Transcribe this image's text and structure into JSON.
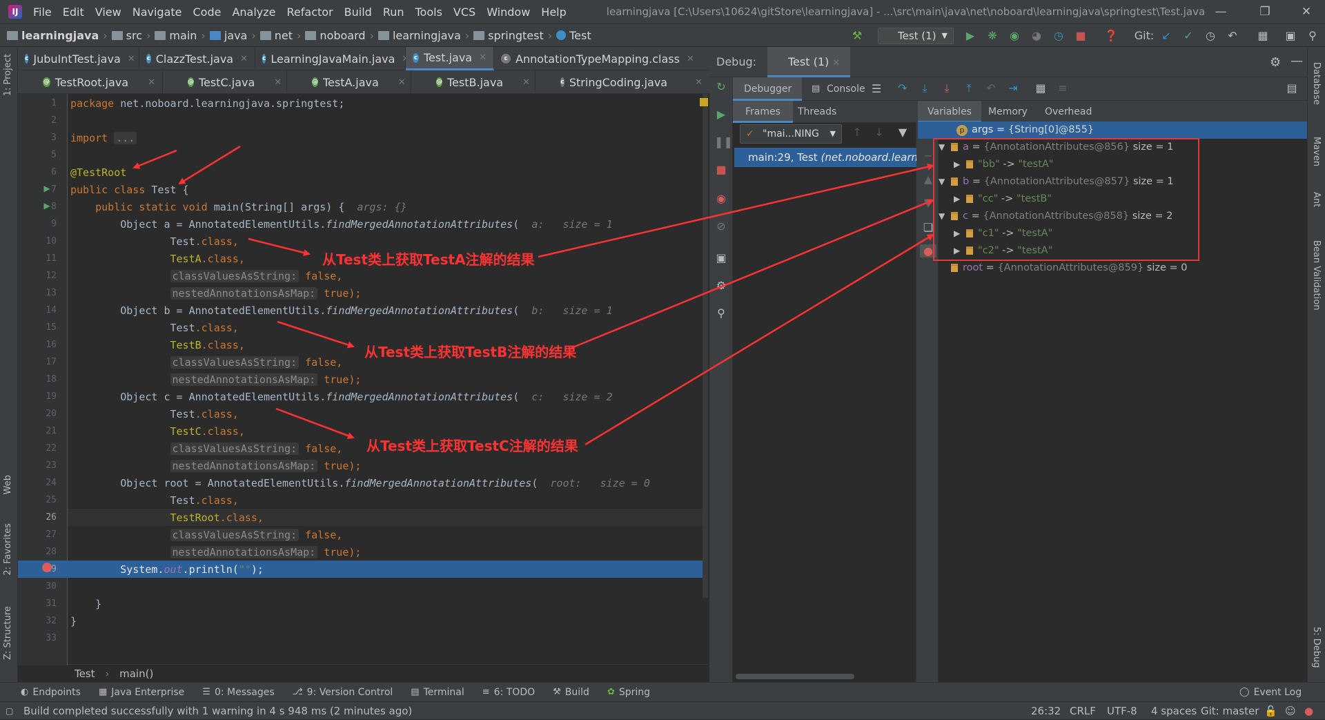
{
  "menu": {
    "items": [
      "File",
      "Edit",
      "View",
      "Navigate",
      "Code",
      "Analyze",
      "Refactor",
      "Build",
      "Run",
      "Tools",
      "VCS",
      "Window",
      "Help"
    ],
    "window_title": "learningjava [C:\\Users\\10624\\gitStore\\learningjava] - ...\\src\\main\\java\\net\\noboard\\learningjava\\springtest\\Test.java"
  },
  "breadcrumb": [
    "learningjava",
    "src",
    "main",
    "java",
    "net",
    "noboard",
    "learningjava",
    "springtest",
    "Test"
  ],
  "toolbar": {
    "run_config": "Test (1)",
    "git_label": "Git:"
  },
  "editor_tabs_row1": [
    {
      "label": "JubuIntTest.java",
      "active": false
    },
    {
      "label": "ClazzTest.java",
      "active": false
    },
    {
      "label": "LearningJavaMain.java",
      "active": false
    },
    {
      "label": "Test.java",
      "active": true
    },
    {
      "label": "AnnotationTypeMapping.class",
      "active": false
    }
  ],
  "editor_tabs_row2": [
    {
      "label": "TestRoot.java"
    },
    {
      "label": "TestC.java"
    },
    {
      "label": "TestA.java"
    },
    {
      "label": "TestB.java"
    },
    {
      "label": "StringCoding.java"
    }
  ],
  "line_numbers": [
    "1",
    "2",
    "3",
    "5",
    "6",
    "7",
    "8",
    "9",
    "10",
    "11",
    "12",
    "13",
    "14",
    "15",
    "16",
    "17",
    "18",
    "19",
    "20",
    "21",
    "22",
    "23",
    "24",
    "25",
    "26",
    "27",
    "28",
    "29",
    "30",
    "31",
    "32",
    "33"
  ],
  "code": {
    "l1_kw": "package",
    "l1_rest": " net.noboard.learningjava.springtest;",
    "l3_kw": "import",
    "l3_fold": "...",
    "l6": "@TestRoot",
    "l7_kw": "public class",
    "l7_rest": " Test {",
    "l8_kw": "public static void",
    "l8_rest": " main(String[] args) {",
    "l8_hint": "args: {}",
    "call": "AnnotatedElementUtils.",
    "method": "findMergedAnnotationAttributes",
    "obj_type": "Object",
    "var_a": "a",
    "var_b": "b",
    "var_c": "c",
    "var_root": "root",
    "hint_a": "a:   size = 1",
    "hint_b": "b:   size = 1",
    "hint_c": "c:   size = 2",
    "hint_root": "root:   size = 0",
    "test_class": "Test",
    "class_suffix": ".class,",
    "testA": "TestA",
    "testB": "TestB",
    "testC": "TestC",
    "testRoot": "TestRoot",
    "param1": "classValuesAsString:",
    "param1_val": "false,",
    "param2": "nestedAnnotationsAsMap:",
    "param2_val": "true);",
    "l29_a": "System.",
    "l29_out": "out",
    "l29_b": ".println(",
    "l29_str": "\"\"",
    "l29_c": ");",
    "close_brace": "}"
  },
  "editor_footer": {
    "class": "Test",
    "method": "main()"
  },
  "annotations": [
    "从Test类上获取TestA注解的结果",
    "从Test类上获取TestB注解的结果",
    "从Test类上获取TestC注解的结果"
  ],
  "debug": {
    "label": "Debug:",
    "session": "Test (1)",
    "tabs": [
      "Debugger",
      "Console"
    ],
    "frames_tabs": [
      "Frames",
      "Threads"
    ],
    "var_tabs": [
      "Variables",
      "Memory",
      "Overhead"
    ],
    "thread": "\"mai...NING",
    "frame": "main:29, Test (net.noboard.learni",
    "frame_a": "main:29, Test ",
    "frame_b": "(net.noboard.learni"
  },
  "variables": [
    {
      "name": "args",
      "value": "{String[0]@855}",
      "level": 0,
      "type": "param"
    },
    {
      "name": "a",
      "value": "{AnnotationAttributes@856}",
      "extra": "size = 1",
      "level": 0,
      "expanded": true
    },
    {
      "name": "\"bb\"",
      "value": "\"testA\"",
      "level": 1
    },
    {
      "name": "b",
      "value": "{AnnotationAttributes@857}",
      "extra": "size = 1",
      "level": 0,
      "expanded": true
    },
    {
      "name": "\"cc\"",
      "value": "\"testB\"",
      "level": 1
    },
    {
      "name": "c",
      "value": "{AnnotationAttributes@858}",
      "extra": "size = 2",
      "level": 0,
      "expanded": true
    },
    {
      "name": "\"c1\"",
      "value": "\"testA\"",
      "level": 1
    },
    {
      "name": "\"c2\"",
      "value": "\"testA\"",
      "level": 1
    },
    {
      "name": "root",
      "value": "{AnnotationAttributes@859}",
      "extra": "size = 0",
      "level": 0
    }
  ],
  "var_eq": " = ",
  "var_arrow": " -> ",
  "bottom_tools": [
    "Endpoints",
    "Java Enterprise",
    "0: Messages",
    "9: Version Control",
    "Terminal",
    "6: TODO",
    "Build",
    "Spring"
  ],
  "event_log": "Event Log",
  "status": {
    "message": "Build completed successfully with 1 warning in 4 s 948 ms (2 minutes ago)",
    "position": "26:32",
    "line_sep": "CRLF",
    "encoding": "UTF-8",
    "indent": "4 spaces",
    "git": "Git: master"
  },
  "left_strip": [
    "1: Project",
    "Web",
    "2: Favorites",
    "Z: Structure"
  ],
  "right_strip": [
    "Database",
    "Maven",
    "Ant",
    "Bean Validation",
    "5: Debug"
  ],
  "colors": {
    "accent": "#2d6099",
    "annotation": "#ff3333",
    "bg": "#2b2b2b",
    "panel": "#3c3f41"
  }
}
